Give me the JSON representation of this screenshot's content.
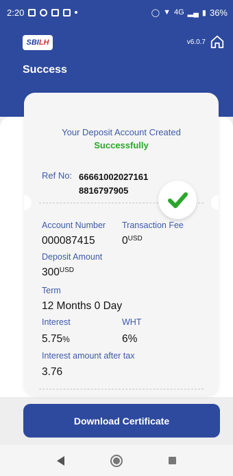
{
  "status_bar": {
    "time": "2:20",
    "network": "4G",
    "battery": "36%"
  },
  "header": {
    "logo_text_a": "SBI",
    "logo_text_b": "LH",
    "version": "v6.0.7",
    "title": "Success"
  },
  "result": {
    "line1": "Your Deposit Account Created",
    "line2": "Successfully",
    "ref_label": "Ref No:",
    "ref_value": "66661002027161 8816797905"
  },
  "details": {
    "account_number_label": "Account Number",
    "account_number": "000087415",
    "transaction_fee_label": "Transaction Fee",
    "transaction_fee": "0",
    "transaction_fee_unit": "USD",
    "deposit_amount_label": "Deposit Amount",
    "deposit_amount": "300",
    "deposit_amount_unit": "USD",
    "term_label": "Term",
    "term": "12 Months 0 Day",
    "interest_label": "Interest",
    "interest": "5.75",
    "interest_unit": "%",
    "wht_label": "WHT",
    "wht": "6%",
    "interest_after_tax_label": "Interest amount after tax",
    "interest_after_tax": "3.76"
  },
  "actions": {
    "download_label": "Download Certificate"
  },
  "colors": {
    "primary": "#2e4a9e",
    "success": "#2ca52c",
    "label": "#3d5aa8"
  }
}
